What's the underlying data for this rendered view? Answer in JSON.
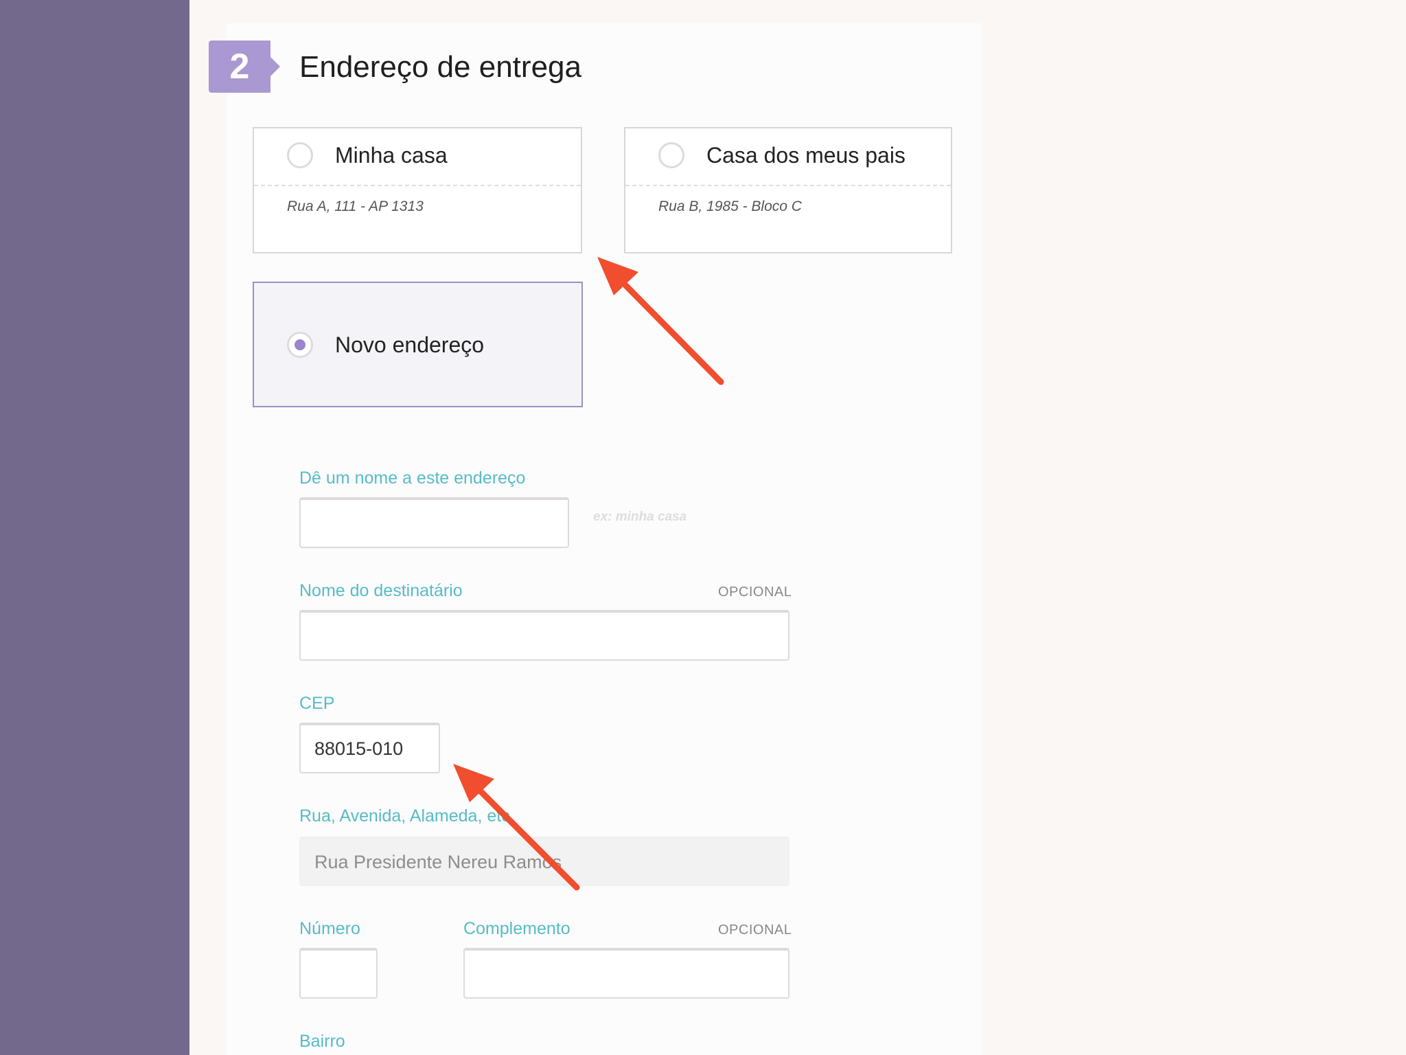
{
  "section": {
    "step_number": "2",
    "title": "Endereço de entrega"
  },
  "address_options": [
    {
      "label": "Minha casa",
      "detail": "Rua A, 111 - AP 1313",
      "selected": false
    },
    {
      "label": "Casa dos meus pais",
      "detail": "Rua B, 1985 - Bloco C",
      "selected": false
    },
    {
      "label": "Novo endereço",
      "selected": true
    }
  ],
  "form": {
    "address_name": {
      "label": "Dê um nome a este endereço",
      "hint": "ex: minha casa",
      "value": ""
    },
    "recipient": {
      "label": "Nome do destinatário",
      "optional_tag": "OPCIONAL",
      "value": ""
    },
    "cep": {
      "label": "CEP",
      "value": "88015-010"
    },
    "street": {
      "label": "Rua, Avenida, Alameda, etc.",
      "value": "Rua Presidente Nereu Ramos"
    },
    "number": {
      "label": "Número",
      "value": ""
    },
    "complement": {
      "label": "Complemento",
      "optional_tag": "OPCIONAL",
      "value": ""
    },
    "neighborhood": {
      "label": "Bairro"
    }
  },
  "colors": {
    "sidebar": "#73698d",
    "accent_purple": "#a998d2",
    "label_teal": "#56bcc6",
    "annotation_arrow": "#f04e2e"
  },
  "icons": [
    "radio-unchecked-icon",
    "radio-checked-icon",
    "annotation-arrow-icon"
  ]
}
